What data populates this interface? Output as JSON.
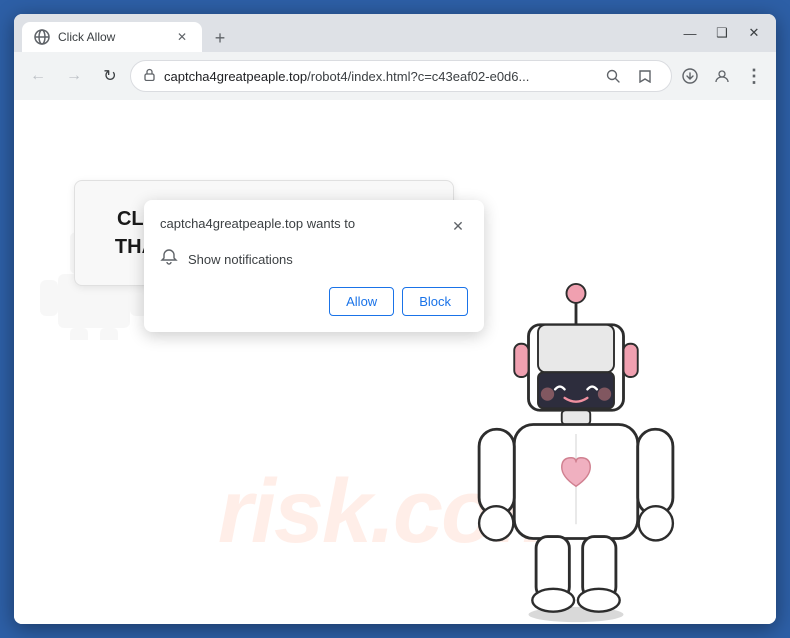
{
  "browser": {
    "tab_title": "Click Allow",
    "tab_favicon": "globe",
    "new_tab_icon": "+",
    "window_controls": {
      "minimize": "—",
      "maximize": "❑",
      "close": "✕"
    }
  },
  "navbar": {
    "back_btn": "←",
    "forward_btn": "→",
    "refresh_btn": "↻",
    "url": "captcha4greatpeaple.top/robot4/index.html?c=c43eaf02-e0d6...",
    "url_domain": "captcha4greatpeaple.top",
    "url_path": "/robot4/index.html?c=c43eaf02-e0d6...",
    "search_icon": "🔍",
    "star_icon": "☆",
    "account_icon": "👤",
    "menu_icon": "⋮",
    "download_icon": "⬇"
  },
  "notification_popup": {
    "site_text": "captcha4greatpeaple.top wants to",
    "notification_text": "Show notifications",
    "allow_label": "Allow",
    "block_label": "Block",
    "close_icon": "✕"
  },
  "page": {
    "captcha_text": "CLICK «ALLOW» TO CONFIRM THAT YOU ARE NOT A ROBOT!",
    "watermark": "risk.com"
  }
}
